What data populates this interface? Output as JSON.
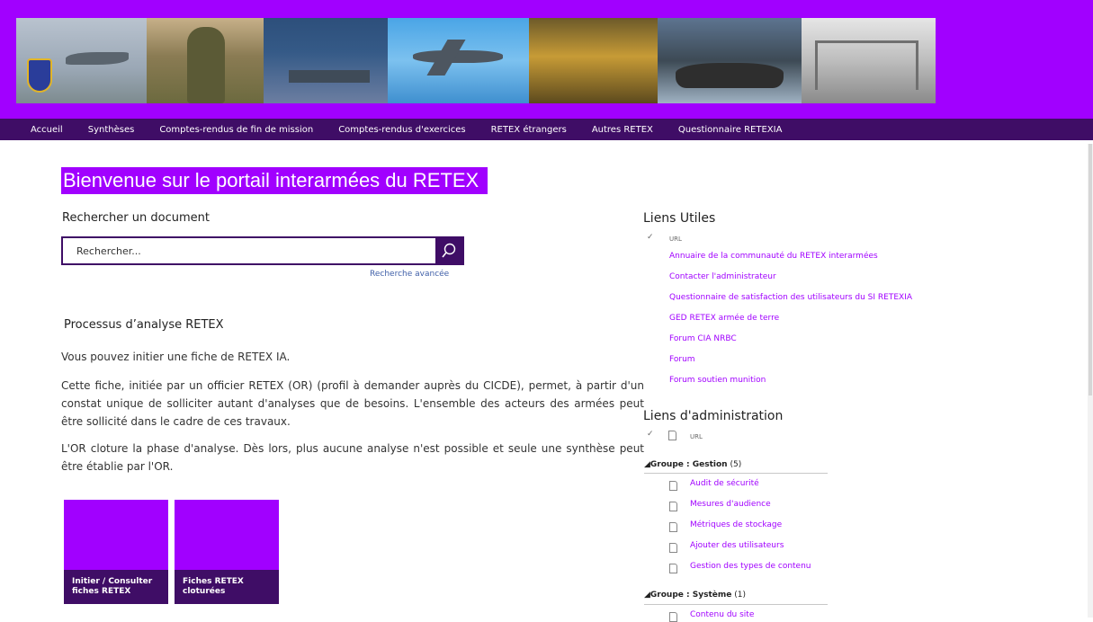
{
  "nav": {
    "items": [
      "Accueil",
      "Synthèses",
      "Comptes-rendus de fin de mission",
      "Comptes-rendus d'exercices",
      "RETEX étrangers",
      "Autres RETEX",
      "Questionnaire RETEXIA"
    ]
  },
  "main": {
    "title": "Bienvenue sur le portail interarmées  du RETEX",
    "search_label": "Rechercher un document",
    "search_placeholder": "Rechercher...",
    "advanced_search": "Recherche avancée",
    "section_title": "Processus d’analyse RETEX",
    "para1": "Vous pouvez initier une fiche de RETEX IA.",
    "para2": "Cette fiche, initiée par un officier RETEX (OR) (profil à demander auprès du CICDE), permet, à partir d'un constat unique de solliciter autant d'analyses que de besoins.  L'ensemble des acteurs des armées peut être sollicité dans le cadre de ces travaux.",
    "para3": "L'OR cloture la phase d'analyse. Dès lors, plus aucune analyse n'est possible et seule une synthèse peut être établie par l'OR.",
    "tiles": [
      "Initier / Consulter fiches RETEX",
      "Fiches RETEX cloturées"
    ]
  },
  "sidebar": {
    "useful_title": "Liens Utiles",
    "check_glyph": "✓",
    "url_label": "URL",
    "useful_links": [
      "Annuaire de la communauté du RETEX interarmées",
      "Contacter l'administrateur",
      "Questionnaire de satisfaction des utilisateurs du SI RETEXIA",
      "GED RETEX armée de terre",
      "Forum CIA NRBC",
      "Forum",
      "Forum soutien munition"
    ],
    "admin_title": "Liens d'administration",
    "admin_url_label": "URL",
    "group1": {
      "name": "Groupe : Gestion",
      "count": "(5)"
    },
    "group1_links": [
      "Audit de sécurité",
      "Mesures d'audience",
      "Métriques de stockage",
      "Ajouter des utilisateurs",
      "Gestion des types de contenu"
    ],
    "group2": {
      "name": "Groupe : Système",
      "count": "(1)"
    },
    "group2_links": [
      "Contenu du site"
    ]
  },
  "colors": {
    "accent": "#a100ff",
    "dark": "#3f0d66",
    "link": "#a100ff"
  },
  "icons": [
    "search-icon",
    "document-icon",
    "checkmark-icon",
    "collapse-triangle-icon"
  ]
}
